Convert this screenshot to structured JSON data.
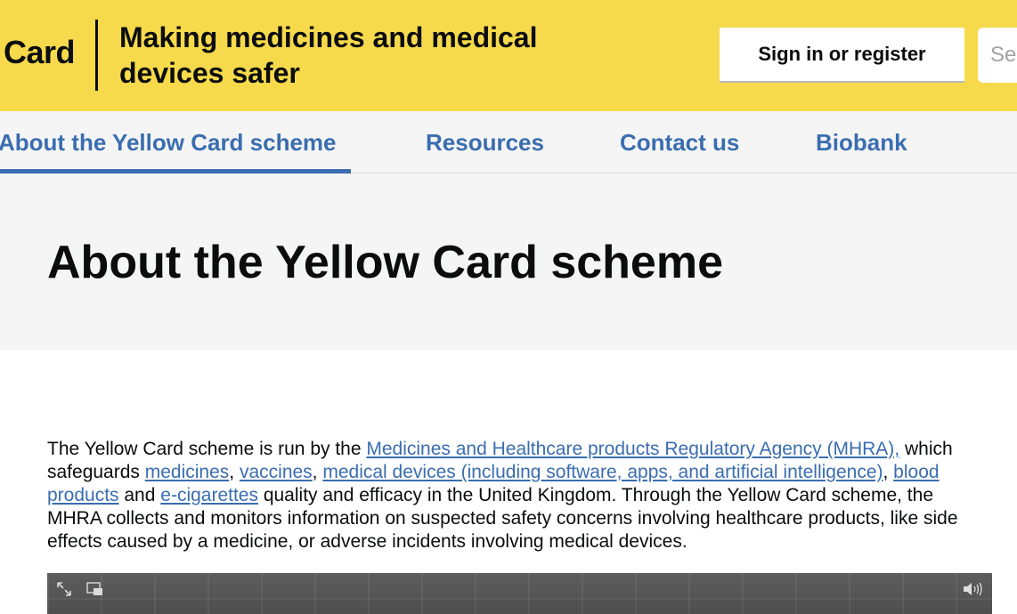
{
  "header": {
    "logo_text": "Card",
    "tagline": "Making medicines and medical devices safer",
    "signin_label": "Sign in or register",
    "search_placeholder": "Search"
  },
  "nav": {
    "items": [
      {
        "label": "About the Yellow Card scheme",
        "active": true
      },
      {
        "label": "Resources",
        "active": false
      },
      {
        "label": "Contact us",
        "active": false
      },
      {
        "label": "Biobank",
        "active": false
      }
    ]
  },
  "main": {
    "title": "About the Yellow Card scheme",
    "intro": {
      "t1": "The Yellow Card scheme is run by the ",
      "link_mhra": "Medicines and Healthcare products Regulatory Agency (MHRA),",
      "t2": " which safeguards ",
      "link_medicines": "medicines",
      "t3": ", ",
      "link_vaccines": "vaccines",
      "t4": ", ",
      "link_devices": "medical devices (including software, apps, and artificial intelligence)",
      "t5": ", ",
      "link_blood": "blood products",
      "t6": " and ",
      "link_ecig": "e-cigarettes",
      "t7": " quality and efficacy in the United Kingdom. Through the Yellow Card scheme, the MHRA collects and monitors information on suspected safety concerns involving healthcare products, like side effects caused by a medicine, or adverse incidents involving medical devices."
    }
  },
  "video": {
    "icons": [
      "expand-icon",
      "picture-in-picture-icon",
      "volume-icon"
    ]
  },
  "colors": {
    "header_bg": "#f7da4b",
    "link": "#3a6db0",
    "nav_bg": "#f5f5f5",
    "text": "#0b0c0c"
  }
}
